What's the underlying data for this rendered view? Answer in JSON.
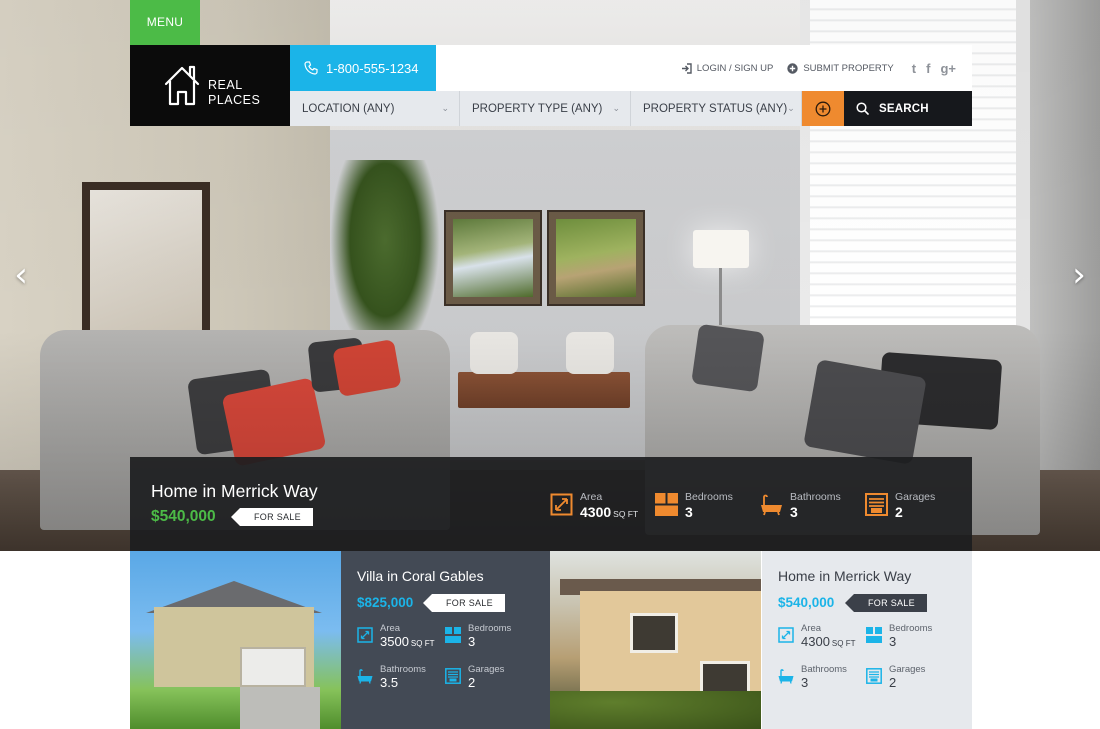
{
  "header": {
    "menu_label": "MENU",
    "logo_line1": "REAL",
    "logo_line2": "PLACES",
    "phone": "1-800-555-1234",
    "login_label": "LOGIN / SIGN UP",
    "submit_label": "SUBMIT PROPERTY",
    "social_icons": [
      "twitter-icon",
      "facebook-icon",
      "google-plus-icon"
    ],
    "social_glyphs": [
      "t",
      "f",
      "g+"
    ]
  },
  "search": {
    "location": "LOCATION (ANY)",
    "property_type": "PROPERTY TYPE (ANY)",
    "property_status": "PROPERTY STATUS (ANY)",
    "search_label": "SEARCH"
  },
  "featured": {
    "title": "Home in Merrick Way",
    "price": "$540,000",
    "status": "FOR SALE",
    "stats": {
      "area_label": "Area",
      "area_value": "4300",
      "area_unit": "SQ FT",
      "bedrooms_label": "Bedrooms",
      "bedrooms_value": "3",
      "bathrooms_label": "Bathrooms",
      "bathrooms_value": "3",
      "garages_label": "Garages",
      "garages_value": "2"
    }
  },
  "listings": [
    {
      "title": "Villa in Coral Gables",
      "price": "$825,000",
      "status": "FOR SALE",
      "area_label": "Area",
      "area_value": "3500",
      "area_unit": "SQ FT",
      "bedrooms_label": "Bedrooms",
      "bedrooms_value": "3",
      "bathrooms_label": "Bathrooms",
      "bathrooms_value": "3.5",
      "garages_label": "Garages",
      "garages_value": "2"
    },
    {
      "title": "Home in Merrick Way",
      "price": "$540,000",
      "status": "FOR SALE",
      "area_label": "Area",
      "area_value": "4300",
      "area_unit": "SQ FT",
      "bedrooms_label": "Bedrooms",
      "bedrooms_value": "3",
      "bathrooms_label": "Bathrooms",
      "bathrooms_value": "3",
      "garages_label": "Garages",
      "garages_value": "2"
    }
  ],
  "colors": {
    "menu_green": "#4cbb47",
    "phone_blue": "#1bb4e8",
    "accent_orange": "#ef8a2f",
    "price_green": "#4cbb47",
    "price_blue": "#1bb4e8",
    "dark_card": "#434a55",
    "light_card": "#e6e9ed"
  }
}
